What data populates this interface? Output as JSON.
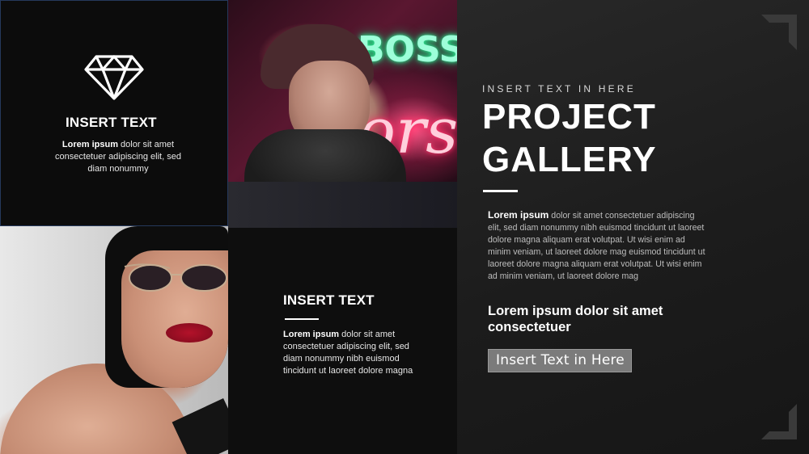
{
  "tile_top_left": {
    "icon": "diamond-icon",
    "heading": "INSERT TEXT",
    "body_bold": "Lorem ipsum",
    "body_rest": " dolor sit amet consectetuer adipiscing elit, sed diam nonummy"
  },
  "tile_neon": {
    "image": "man-with-neon-signs-photo",
    "sign_text_green": "BOSS",
    "sign_text_pink": "ors"
  },
  "tile_woman": {
    "image": "woman-with-sunglasses-photo"
  },
  "tile_bottom_middle": {
    "heading": "INSERT TEXT",
    "body_bold": "Lorem ipsum",
    "body_rest": " dolor sit amet consectetuer adipiscing elit, sed diam nonummy nibh euismod tincidunt ut laoreet dolore magna"
  },
  "right_panel": {
    "subtitle": "INSERT TEXT IN HERE",
    "title_line1": "PROJECT",
    "title_line2": "GALLERY",
    "body_bold": "Lorem  ipsum",
    "body_rest": " dolor sit amet consectetuer adipiscing elit, sed diam nonummy nibh euismod tincidunt ut laoreet dolore magna aliquam erat volutpat. Ut wisi enim ad minim veniam, ut laoreet dolore mag euismod tincidunt ut laoreet dolore magna aliquam erat volutpat. Ut wisi enim ad minim veniam, ut laoreet dolore mag",
    "headline": "Lorem ipsum dolor sit amet consectetuer",
    "cta_label": "Insert Text in Here"
  },
  "colors": {
    "panel_bg": "#1c1c1c",
    "tile_dark": "#0c0c0c",
    "cta_bg": "#7b7b7b",
    "accent_white": "#ffffff"
  }
}
